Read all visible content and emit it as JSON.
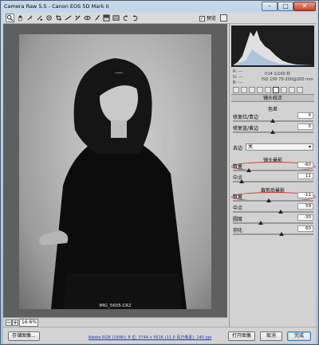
{
  "window": {
    "title": "Camera Raw 5.5 -  Canon EOS 5D Mark II",
    "minimize": "–",
    "maximize": "□",
    "close": "✕"
  },
  "toolbar": {
    "tools": [
      "zoom-icon",
      "hand-icon",
      "white-balance-icon",
      "color-sampler-icon",
      "target-adjust-icon",
      "crop-icon",
      "straighten-icon",
      "spot-removal-icon",
      "red-eye-icon",
      "adjustment-brush-icon",
      "graduated-filter-icon",
      "preferences-icon",
      "rotate-left-icon",
      "rotate-right-icon"
    ],
    "preview_label": "预览",
    "preview_checked": "✓"
  },
  "image": {
    "caption": "IMG_5605.CR2",
    "zoom_value": "16.6%",
    "zoom_out": "−",
    "zoom_in": "+"
  },
  "histogram": {
    "r_label": "R:",
    "g_label": "G:",
    "b_label": "B:",
    "r_val": "---",
    "g_val": "---",
    "b_val": "---",
    "aperture_shutter": "f/14   1/160 秒",
    "iso_lens": "ISO 100   70-200@200 mm"
  },
  "panel": {
    "title": "镜头校正",
    "chromatic_header": "色差",
    "ca_red_cyan_label": "修复红/青边",
    "ca_red_cyan_value": "0",
    "ca_blue_yellow_label": "修复蓝/黄边",
    "ca_blue_yellow_value": "0",
    "defringe_label": "去边",
    "defringe_value": "关",
    "lens_vignetting_header": "镜头晕影",
    "lens_amount_label": "数量",
    "lens_amount_value": "-60",
    "lens_midpoint_label": "中点",
    "lens_midpoint_value": "11",
    "post_crop_header": "裁剪后晕影",
    "pc_amount_label": "数量",
    "pc_amount_value": "-11",
    "pc_midpoint_label": "中点",
    "pc_midpoint_value": "59",
    "pc_roundness_label": "圆度",
    "pc_roundness_value": "-30",
    "pc_feather_label": "羽化",
    "pc_feather_value": "60"
  },
  "bottom": {
    "save_label": "存储图像...",
    "workflow_link": "Adobe RGB (1998); 8 位; 3744 x 5616 (21.0 百万像素); 240 ppi",
    "open_label": "打开图像",
    "cancel_label": "取消",
    "done_label": "完成"
  },
  "colors": {
    "accent_ring": "#d23a3a",
    "link_blue": "#1a3cc0"
  }
}
